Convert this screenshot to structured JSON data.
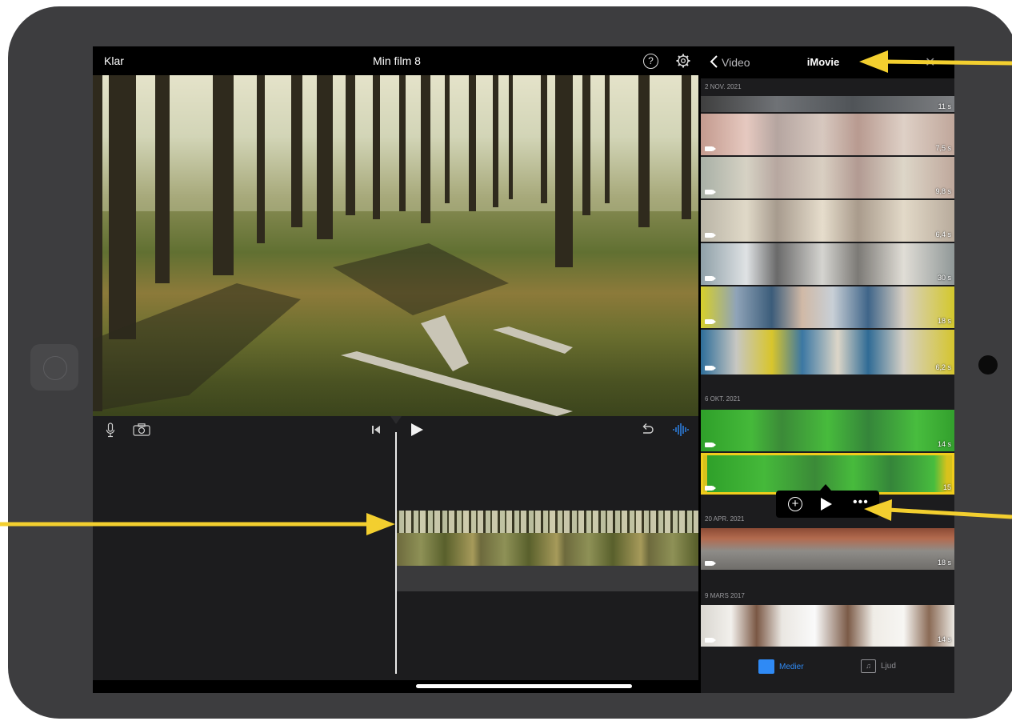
{
  "editor": {
    "done_label": "Klar",
    "project_title": "Min film 8",
    "help_label": "?"
  },
  "browser": {
    "back_label": "Video",
    "title": "iMovie",
    "close_label": "✕",
    "sections": [
      {
        "date": "2 NOV. 2021",
        "durations": [
          "11 s",
          "7,5 s",
          "9,8 s",
          "6,4 s",
          "30 s",
          "18 s",
          "6,2 s"
        ]
      },
      {
        "date": "6 OKT. 2021",
        "durations": [
          "14 s",
          "15"
        ]
      },
      {
        "date": "20 APR. 2021",
        "durations": [
          "18 s"
        ]
      },
      {
        "date": "9 MARS 2017",
        "durations": [
          "14 s"
        ]
      }
    ],
    "popup": {
      "add": "+",
      "more": "•••"
    },
    "tabs": {
      "media": "Medier",
      "audio": "Ljud",
      "audio_icon": "♫"
    }
  },
  "colors": {
    "accent": "#2f8af5",
    "selection": "#f0cc1c",
    "annotation_arrow": "#f3cf2f"
  },
  "icons": [
    "help-icon",
    "gear-icon",
    "mic-icon",
    "camera-icon",
    "skip-back-icon",
    "play-icon",
    "undo-icon",
    "waveform-icon",
    "chevron-left-icon",
    "close-icon",
    "add-icon",
    "more-icon",
    "film-strip-icon",
    "music-note-icon"
  ]
}
